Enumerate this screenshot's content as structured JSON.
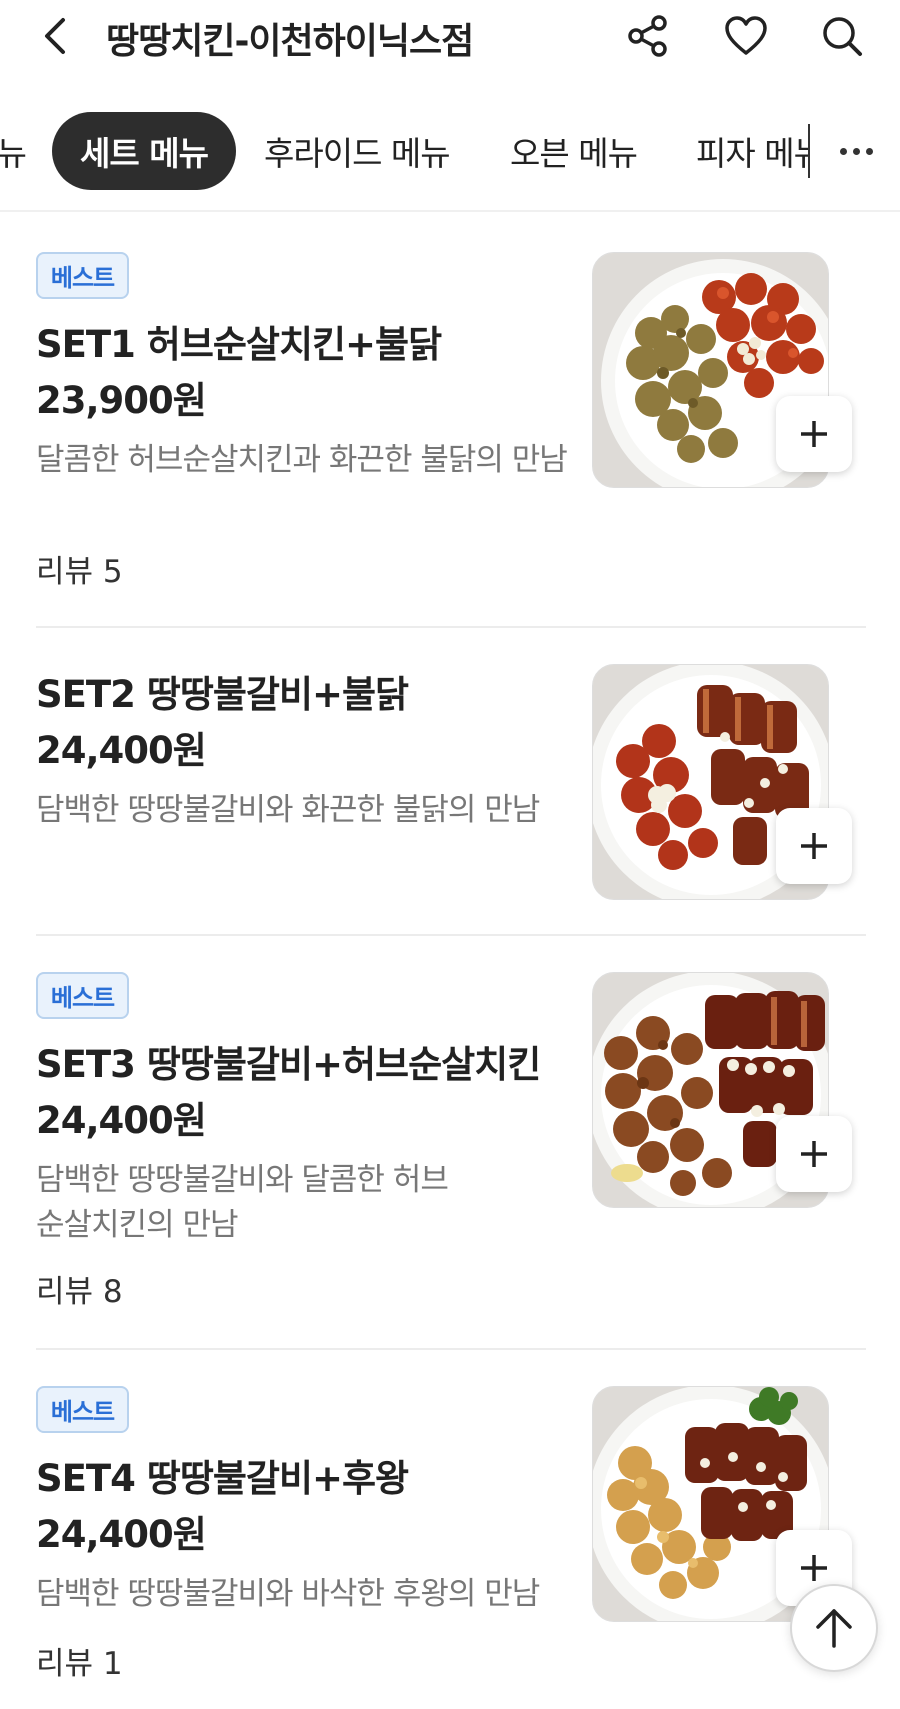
{
  "header": {
    "store_name": "땅땅치킨-이천하이닉스점",
    "icons": [
      "back-icon",
      "share-icon",
      "heart-icon",
      "search-icon"
    ]
  },
  "tabs": {
    "prev_partial": "뉴",
    "items": [
      "세트 메뉴",
      "후라이드 메뉴",
      "오븐 메뉴",
      "피자 메뉴"
    ],
    "active": "세트 메뉴",
    "more_icon": "more-dots-icon"
  },
  "menu": [
    {
      "badge": "베스트",
      "name": "SET1 허브순살치킨+불닭",
      "price": "23,900원",
      "description": "달콤한 허브순살치킨과 화끈한 불닭의 만남",
      "review": "리뷰 5"
    },
    {
      "badge": "",
      "name": "SET2 땅땅불갈비+불닭",
      "price": "24,400원",
      "description": "담백한 땅땅불갈비와 화끈한 불닭의 만남",
      "review": ""
    },
    {
      "badge": "베스트",
      "name": "SET3 땅땅불갈비+허브순살치킨",
      "price": "24,400원",
      "description": "담백한 땅땅불갈비와 달콤한 허브순살치킨의 만남",
      "review": "리뷰 8"
    },
    {
      "badge": "베스트",
      "name": "SET4 땅땅불갈비+후왕",
      "price": "24,400원",
      "description": "담백한 땅땅불갈비와 바삭한 후왕의 만남",
      "review": "리뷰 1"
    }
  ],
  "colors": {
    "active_tab_bg": "#2d2d2d",
    "badge_text": "#2a6fd6",
    "badge_bg": "#e9f2fc",
    "description": "#777777"
  },
  "scroll_top_icon": "arrow-up-icon"
}
